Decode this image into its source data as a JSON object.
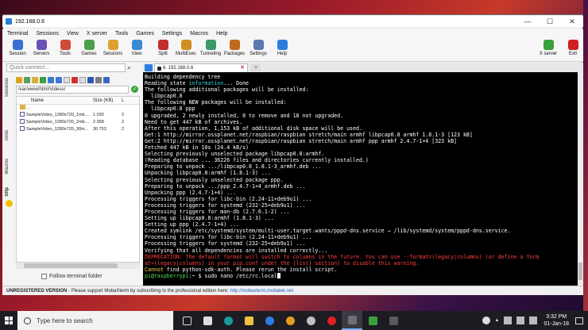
{
  "window": {
    "title": "192.168.0.6",
    "controls": [
      "—",
      "☐",
      "✕"
    ]
  },
  "menubar": [
    "Terminal",
    "Sessions",
    "View",
    "X server",
    "Tools",
    "Games",
    "Settings",
    "Macros",
    "Help"
  ],
  "toolbar": {
    "buttons": [
      {
        "label": "Session",
        "icon": "session-icon",
        "color": "#3b6fd0"
      },
      {
        "label": "Servers",
        "icon": "servers-icon",
        "color": "#6a4fb5"
      },
      {
        "label": "Tools",
        "icon": "tools-icon",
        "color": "#d04a3a"
      },
      {
        "label": "Games",
        "icon": "games-icon",
        "color": "#4aa04a"
      },
      {
        "label": "Sessions",
        "icon": "sessions-icon",
        "color": "#e0a030"
      },
      {
        "label": "View",
        "icon": "view-icon",
        "color": "#3a8ad0"
      },
      {
        "label": "Split",
        "icon": "split-icon",
        "color": "#c03030"
      },
      {
        "label": "MultiExec",
        "icon": "multiexec-icon",
        "color": "#d09020"
      },
      {
        "label": "Tunneling",
        "icon": "tunneling-icon",
        "color": "#3a9a6a"
      },
      {
        "label": "Packages",
        "icon": "packages-icon",
        "color": "#c06a20"
      },
      {
        "label": "Settings",
        "icon": "settings-icon",
        "color": "#5a7ab0"
      },
      {
        "label": "Help",
        "icon": "help-icon",
        "color": "#2b7ee0"
      }
    ],
    "right_buttons": [
      {
        "label": "X server",
        "icon": "x-server-icon",
        "color": "#3aa03a"
      },
      {
        "label": "Exit",
        "icon": "exit-icon",
        "color": "#d02020"
      }
    ]
  },
  "sidebar": {
    "quick_connect_placeholder": "Quick connect...",
    "vertical_tabs": [
      "Sessions",
      "Tools",
      "Macros",
      "Sftp"
    ],
    "path": "/var/www/html/Videos/",
    "columns": [
      "Name",
      "Size (KB)",
      "L"
    ],
    "files": [
      {
        "name": "..",
        "size": "",
        "last": ""
      },
      {
        "name": "SampleVideo_1280x720_1mb....",
        "size": "1 030",
        "last": "2"
      },
      {
        "name": "SampleVideo_1280x720_2mb....",
        "size": "2 058",
        "last": "2"
      },
      {
        "name": "SampleVideo_1280x720_30m...",
        "size": "30 753",
        "last": "2"
      }
    ],
    "follow_label": "Follow terminal folder"
  },
  "terminal": {
    "tab_title": "6. 192.168.0.6",
    "lines": [
      [
        {
          "t": "Building dependency tree"
        }
      ],
      [
        {
          "t": "Reading state "
        },
        {
          "t": "information",
          "c": "cyan"
        },
        {
          "t": "... Done"
        }
      ],
      [
        {
          "t": "The following additional packages will be installed:"
        }
      ],
      [
        {
          "t": "  libpcap0.8"
        }
      ],
      [
        {
          "t": "The following NEW packages will be installed:"
        }
      ],
      [
        {
          "t": "  libpcap0.8 ppp"
        }
      ],
      [
        {
          "t": "0 upgraded, 2 newly installed, 0 to remove and 18 not upgraded."
        }
      ],
      [
        {
          "t": "Need to get 447 kB of archives."
        }
      ],
      [
        {
          "t": "After this operation, 1,153 kB of additional disk space will be used."
        }
      ],
      [
        {
          "t": "Get:1 http://mirror.ossplanet.net/raspbian/raspbian stretch/main armhf libpcap0.8 armhf 1.8.1-3 [123 kB]"
        }
      ],
      [
        {
          "t": "Get:2 http://mirror.ossplanet.net/raspbian/raspbian stretch/main armhf ppp armhf 2.4.7-1+4 [323 kB]"
        }
      ],
      [
        {
          "t": "Fetched 447 kB in 10s (24.4 kB/s)"
        }
      ],
      [
        {
          "t": "Selecting previously unselected package libpcap0.8:armhf."
        }
      ],
      [
        {
          "t": "(Reading database ... 36226 files and directories currently installed.)"
        }
      ],
      [
        {
          "t": "Preparing to unpack .../libpcap0.8_1.8.1-3_armhf.deb ..."
        }
      ],
      [
        {
          "t": "Unpacking libpcap0.8:armhf (1.8.1-3) ..."
        }
      ],
      [
        {
          "t": "Selecting previously unselected package ppp."
        }
      ],
      [
        {
          "t": "Preparing to unpack .../ppp_2.4.7-1+4_armhf.deb ..."
        }
      ],
      [
        {
          "t": "Unpacking ppp (2.4.7-1+4) ..."
        }
      ],
      [
        {
          "t": "Processing triggers for libc-bin (2.24-11+deb9u1) ..."
        }
      ],
      [
        {
          "t": "Processing triggers for systemd (232-25+deb9u1) ..."
        }
      ],
      [
        {
          "t": "Processing triggers for man-db (2.7.6.1-2) ..."
        }
      ],
      [
        {
          "t": "Setting up libpcap0.8:armhf (1.8.1-3) ..."
        }
      ],
      [
        {
          "t": "Setting up ppp (2.4.7-1+4) ..."
        }
      ],
      [
        {
          "t": "Created symlink /etc/systemd/system/multi-user.target.wants/pppd-dns.service → /lib/systemd/system/pppd-dns.service."
        }
      ],
      [
        {
          "t": "Processing triggers for libc-bin (2.24-11+deb9u1) ..."
        }
      ],
      [
        {
          "t": "Processing triggers for systemd (232-25+deb9u1) ..."
        }
      ],
      [
        {
          "t": "Verifying that all dependencies are installed correctly..."
        }
      ],
      [
        {
          "t": "DEPRECATION: The default format will switch to columns in the future. You can use --format=(legacy|columns) (or define a form",
          "c": "red"
        }
      ],
      [
        {
          "t": "at=(legacy|columns) in your pip.conf under the [list] section) to disable this warning.",
          "c": "red"
        }
      ],
      [
        {
          "t": "Cannot",
          "c": "yellow"
        },
        {
          "t": " find python-sdk-auth. Please rerun the install script."
        }
      ],
      [
        {
          "t": "pi@raspberrypi",
          "c": "green"
        },
        {
          "t": ":~ $ sudo nano /etc/rc.local"
        }
      ]
    ]
  },
  "statusbar": {
    "label": "UNREGISTERED VERSION",
    "message": "  -  Please support MobaXterm by subscribing to the professional edition here:  ",
    "link": "http://mobaxterm.mobatek.net"
  },
  "taskbar": {
    "search_placeholder": "Type here to search",
    "time": "3:32 PM",
    "date": "01-Jan-18"
  }
}
